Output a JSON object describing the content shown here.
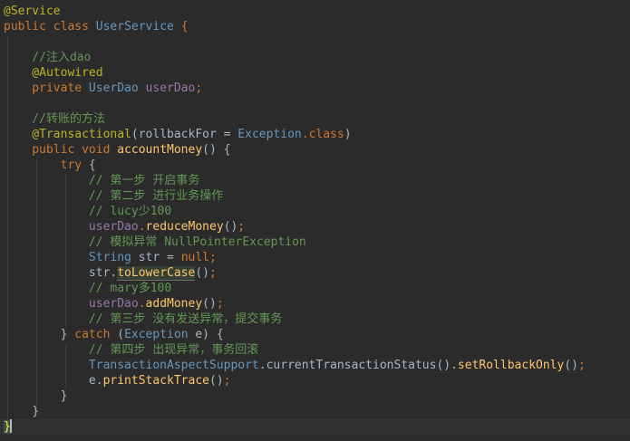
{
  "lines": [
    [
      {
        "t": "@Service",
        "c": "ann"
      }
    ],
    [
      {
        "t": "public ",
        "c": "kw"
      },
      {
        "t": "class ",
        "c": "kw"
      },
      {
        "t": "UserService ",
        "c": "cls"
      },
      {
        "t": "{",
        "c": "kw"
      }
    ],
    [],
    [
      {
        "t": "    //注入dao",
        "c": "cmt"
      }
    ],
    [
      {
        "t": "    @Autowired",
        "c": "ann"
      }
    ],
    [
      {
        "t": "    private ",
        "c": "kw"
      },
      {
        "t": "UserDao ",
        "c": "cls"
      },
      {
        "t": "userDao",
        "c": "fld"
      },
      {
        "t": ";",
        "c": "kw"
      }
    ],
    [],
    [
      {
        "t": "    //转账的方法",
        "c": "cmt"
      }
    ],
    [
      {
        "t": "    @Transactional",
        "c": "ann"
      },
      {
        "t": "(rollbackFor = ",
        "c": "ident"
      },
      {
        "t": "Exception",
        "c": "cls"
      },
      {
        "t": ".class",
        "c": "kw"
      },
      {
        "t": ")",
        "c": "ident"
      }
    ],
    [
      {
        "t": "    public ",
        "c": "kw"
      },
      {
        "t": "void ",
        "c": "kw"
      },
      {
        "t": "accountMoney",
        "c": "meth"
      },
      {
        "t": "() {",
        "c": "ident"
      }
    ],
    [
      {
        "t": "        try ",
        "c": "kw"
      },
      {
        "t": "{",
        "c": "ident"
      }
    ],
    [
      {
        "t": "            // 第一步 开启事务",
        "c": "cmt"
      }
    ],
    [
      {
        "t": "            // 第二步 进行业务操作",
        "c": "cmt"
      }
    ],
    [
      {
        "t": "            // lucy少100",
        "c": "cmt"
      }
    ],
    [
      {
        "t": "            userDao",
        "c": "fld"
      },
      {
        "t": ".",
        "c": "kw"
      },
      {
        "t": "reduceMoney",
        "c": "meth"
      },
      {
        "t": "()",
        "c": "ident"
      },
      {
        "t": ";",
        "c": "kw"
      }
    ],
    [
      {
        "t": "            // 模拟异常 NullPointerException",
        "c": "cmt"
      }
    ],
    [
      {
        "t": "            String ",
        "c": "cls"
      },
      {
        "t": "str = ",
        "c": "ident"
      },
      {
        "t": "null",
        "c": "kw"
      },
      {
        "t": ";",
        "c": "kw"
      }
    ],
    [
      {
        "t": "            str.",
        "c": "ident"
      },
      {
        "t": "toLowerCase",
        "c": "meth",
        "h": true
      },
      {
        "t": "()",
        "c": "ident"
      },
      {
        "t": ";",
        "c": "kw"
      }
    ],
    [
      {
        "t": "            // mary多100",
        "c": "cmt"
      }
    ],
    [
      {
        "t": "            userDao",
        "c": "fld"
      },
      {
        "t": ".",
        "c": "kw"
      },
      {
        "t": "addMoney",
        "c": "meth"
      },
      {
        "t": "()",
        "c": "ident"
      },
      {
        "t": ";",
        "c": "kw"
      }
    ],
    [
      {
        "t": "            // 第三步 没有发送异常，提交事务",
        "c": "cmt"
      }
    ],
    [
      {
        "t": "        } ",
        "c": "ident"
      },
      {
        "t": "catch ",
        "c": "kw"
      },
      {
        "t": "(",
        "c": "ident"
      },
      {
        "t": "Exception ",
        "c": "cls"
      },
      {
        "t": "e) {",
        "c": "ident"
      }
    ],
    [
      {
        "t": "            // 第四步 出现异常，事务回滚",
        "c": "cmt"
      }
    ],
    [
      {
        "t": "            TransactionAspectSupport",
        "c": "cls"
      },
      {
        "t": ".",
        "c": "ident"
      },
      {
        "t": "currentTransactionStatus",
        "c": "ident"
      },
      {
        "t": "().",
        "c": "ident"
      },
      {
        "t": "setRollbackOnly",
        "c": "meth"
      },
      {
        "t": "()",
        "c": "ident"
      },
      {
        "t": ";",
        "c": "kw"
      }
    ],
    [
      {
        "t": "            e.",
        "c": "ident"
      },
      {
        "t": "printStackTrace",
        "c": "meth"
      },
      {
        "t": "()",
        "c": "ident"
      },
      {
        "t": ";",
        "c": "kw"
      }
    ],
    [
      {
        "t": "        }",
        "c": "ident"
      }
    ],
    [
      {
        "t": "    }",
        "c": "ident"
      }
    ],
    [
      {
        "t": "}",
        "c": "kw",
        "b": true
      }
    ]
  ],
  "caret_line": 27,
  "theme": {
    "background": "#2b2b2b",
    "current_line": "#323232",
    "keyword": "#cc7832",
    "annotation": "#bbb529",
    "type": "#6897bb",
    "field": "#9876aa",
    "comment": "#629755",
    "method": "#ffc66d",
    "text": "#a9b7c6"
  }
}
